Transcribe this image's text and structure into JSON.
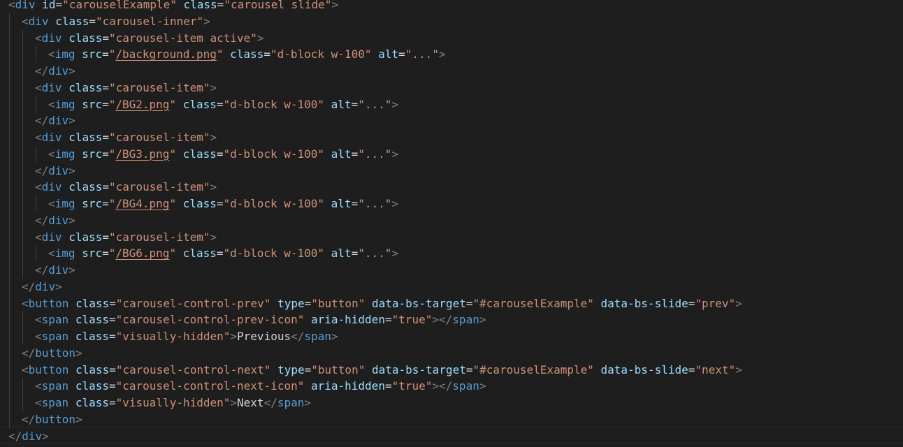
{
  "editor": {
    "language": "html",
    "theme": {
      "background": "#1e1e1e",
      "tag": "#569cd6",
      "attribute": "#9cdcfe",
      "string": "#ce9178",
      "punctuation": "#808080",
      "text": "#d4d4d4"
    },
    "lines": [
      [
        {
          "t": "p",
          "v": "<"
        },
        {
          "t": "tag",
          "v": "div"
        },
        {
          "t": "ws",
          "v": " "
        },
        {
          "t": "attr",
          "v": "id"
        },
        {
          "t": "eq",
          "v": "="
        },
        {
          "t": "str",
          "v": "\"carouselExample\""
        },
        {
          "t": "ws",
          "v": " "
        },
        {
          "t": "attr",
          "v": "class"
        },
        {
          "t": "eq",
          "v": "="
        },
        {
          "t": "str",
          "v": "\"carousel slide\""
        },
        {
          "t": "p",
          "v": ">"
        }
      ],
      [
        {
          "t": "p",
          "v": "<"
        },
        {
          "t": "tag",
          "v": "div"
        },
        {
          "t": "ws",
          "v": " "
        },
        {
          "t": "attr",
          "v": "class"
        },
        {
          "t": "eq",
          "v": "="
        },
        {
          "t": "str",
          "v": "\"carousel-inner\""
        },
        {
          "t": "p",
          "v": ">"
        }
      ],
      [
        {
          "t": "p",
          "v": "<"
        },
        {
          "t": "tag",
          "v": "div"
        },
        {
          "t": "ws",
          "v": " "
        },
        {
          "t": "attr",
          "v": "class"
        },
        {
          "t": "eq",
          "v": "="
        },
        {
          "t": "str",
          "v": "\"carousel-item active\""
        },
        {
          "t": "p",
          "v": ">"
        }
      ],
      [
        {
          "t": "p",
          "v": "<"
        },
        {
          "t": "tag",
          "v": "img"
        },
        {
          "t": "ws",
          "v": " "
        },
        {
          "t": "attr",
          "v": "src"
        },
        {
          "t": "eq",
          "v": "="
        },
        {
          "t": "str",
          "v": "\""
        },
        {
          "t": "link",
          "v": "/background.png"
        },
        {
          "t": "str",
          "v": "\""
        },
        {
          "t": "ws",
          "v": " "
        },
        {
          "t": "attr",
          "v": "class"
        },
        {
          "t": "eq",
          "v": "="
        },
        {
          "t": "str",
          "v": "\"d-block w-100\""
        },
        {
          "t": "ws",
          "v": " "
        },
        {
          "t": "attr",
          "v": "alt"
        },
        {
          "t": "eq",
          "v": "="
        },
        {
          "t": "str",
          "v": "\"...\""
        },
        {
          "t": "p",
          "v": ">"
        }
      ],
      [
        {
          "t": "p",
          "v": "</"
        },
        {
          "t": "tag",
          "v": "div"
        },
        {
          "t": "p",
          "v": ">"
        }
      ],
      [
        {
          "t": "p",
          "v": "<"
        },
        {
          "t": "tag",
          "v": "div"
        },
        {
          "t": "ws",
          "v": " "
        },
        {
          "t": "attr",
          "v": "class"
        },
        {
          "t": "eq",
          "v": "="
        },
        {
          "t": "str",
          "v": "\"carousel-item\""
        },
        {
          "t": "p",
          "v": ">"
        }
      ],
      [
        {
          "t": "p",
          "v": "<"
        },
        {
          "t": "tag",
          "v": "img"
        },
        {
          "t": "ws",
          "v": " "
        },
        {
          "t": "attr",
          "v": "src"
        },
        {
          "t": "eq",
          "v": "="
        },
        {
          "t": "str",
          "v": "\""
        },
        {
          "t": "link",
          "v": "/BG2.png"
        },
        {
          "t": "str",
          "v": "\""
        },
        {
          "t": "ws",
          "v": " "
        },
        {
          "t": "attr",
          "v": "class"
        },
        {
          "t": "eq",
          "v": "="
        },
        {
          "t": "str",
          "v": "\"d-block w-100\""
        },
        {
          "t": "ws",
          "v": " "
        },
        {
          "t": "attr",
          "v": "alt"
        },
        {
          "t": "eq",
          "v": "="
        },
        {
          "t": "str",
          "v": "\"...\""
        },
        {
          "t": "p",
          "v": ">"
        }
      ],
      [
        {
          "t": "p",
          "v": "</"
        },
        {
          "t": "tag",
          "v": "div"
        },
        {
          "t": "p",
          "v": ">"
        }
      ],
      [
        {
          "t": "p",
          "v": "<"
        },
        {
          "t": "tag",
          "v": "div"
        },
        {
          "t": "ws",
          "v": " "
        },
        {
          "t": "attr",
          "v": "class"
        },
        {
          "t": "eq",
          "v": "="
        },
        {
          "t": "str",
          "v": "\"carousel-item\""
        },
        {
          "t": "p",
          "v": ">"
        }
      ],
      [
        {
          "t": "p",
          "v": "<"
        },
        {
          "t": "tag",
          "v": "img"
        },
        {
          "t": "ws",
          "v": " "
        },
        {
          "t": "attr",
          "v": "src"
        },
        {
          "t": "eq",
          "v": "="
        },
        {
          "t": "str",
          "v": "\""
        },
        {
          "t": "link",
          "v": "/BG3.png"
        },
        {
          "t": "str",
          "v": "\""
        },
        {
          "t": "ws",
          "v": " "
        },
        {
          "t": "attr",
          "v": "class"
        },
        {
          "t": "eq",
          "v": "="
        },
        {
          "t": "str",
          "v": "\"d-block w-100\""
        },
        {
          "t": "ws",
          "v": " "
        },
        {
          "t": "attr",
          "v": "alt"
        },
        {
          "t": "eq",
          "v": "="
        },
        {
          "t": "str",
          "v": "\"...\""
        },
        {
          "t": "p",
          "v": ">"
        }
      ],
      [
        {
          "t": "p",
          "v": "</"
        },
        {
          "t": "tag",
          "v": "div"
        },
        {
          "t": "p",
          "v": ">"
        }
      ],
      [
        {
          "t": "p",
          "v": "<"
        },
        {
          "t": "tag",
          "v": "div"
        },
        {
          "t": "ws",
          "v": " "
        },
        {
          "t": "attr",
          "v": "class"
        },
        {
          "t": "eq",
          "v": "="
        },
        {
          "t": "str",
          "v": "\"carousel-item\""
        },
        {
          "t": "p",
          "v": ">"
        }
      ],
      [
        {
          "t": "p",
          "v": "<"
        },
        {
          "t": "tag",
          "v": "img"
        },
        {
          "t": "ws",
          "v": " "
        },
        {
          "t": "attr",
          "v": "src"
        },
        {
          "t": "eq",
          "v": "="
        },
        {
          "t": "str",
          "v": "\""
        },
        {
          "t": "link",
          "v": "/BG4.png"
        },
        {
          "t": "str",
          "v": "\""
        },
        {
          "t": "ws",
          "v": " "
        },
        {
          "t": "attr",
          "v": "class"
        },
        {
          "t": "eq",
          "v": "="
        },
        {
          "t": "str",
          "v": "\"d-block w-100\""
        },
        {
          "t": "ws",
          "v": " "
        },
        {
          "t": "attr",
          "v": "alt"
        },
        {
          "t": "eq",
          "v": "="
        },
        {
          "t": "str",
          "v": "\"...\""
        },
        {
          "t": "p",
          "v": ">"
        }
      ],
      [
        {
          "t": "p",
          "v": "</"
        },
        {
          "t": "tag",
          "v": "div"
        },
        {
          "t": "p",
          "v": ">"
        }
      ],
      [
        {
          "t": "p",
          "v": "<"
        },
        {
          "t": "tag",
          "v": "div"
        },
        {
          "t": "ws",
          "v": " "
        },
        {
          "t": "attr",
          "v": "class"
        },
        {
          "t": "eq",
          "v": "="
        },
        {
          "t": "str",
          "v": "\"carousel-item\""
        },
        {
          "t": "p",
          "v": ">"
        }
      ],
      [
        {
          "t": "p",
          "v": "<"
        },
        {
          "t": "tag",
          "v": "img"
        },
        {
          "t": "ws",
          "v": " "
        },
        {
          "t": "attr",
          "v": "src"
        },
        {
          "t": "eq",
          "v": "="
        },
        {
          "t": "str",
          "v": "\""
        },
        {
          "t": "link",
          "v": "/BG6.png"
        },
        {
          "t": "str",
          "v": "\""
        },
        {
          "t": "ws",
          "v": " "
        },
        {
          "t": "attr",
          "v": "class"
        },
        {
          "t": "eq",
          "v": "="
        },
        {
          "t": "str",
          "v": "\"d-block w-100\""
        },
        {
          "t": "ws",
          "v": " "
        },
        {
          "t": "attr",
          "v": "alt"
        },
        {
          "t": "eq",
          "v": "="
        },
        {
          "t": "str",
          "v": "\"...\""
        },
        {
          "t": "p",
          "v": ">"
        }
      ],
      [
        {
          "t": "p",
          "v": "</"
        },
        {
          "t": "tag",
          "v": "div"
        },
        {
          "t": "p",
          "v": ">"
        }
      ],
      [
        {
          "t": "p",
          "v": "</"
        },
        {
          "t": "tag",
          "v": "div"
        },
        {
          "t": "p",
          "v": ">"
        }
      ],
      [
        {
          "t": "p",
          "v": "<"
        },
        {
          "t": "tag",
          "v": "button"
        },
        {
          "t": "ws",
          "v": " "
        },
        {
          "t": "attr",
          "v": "class"
        },
        {
          "t": "eq",
          "v": "="
        },
        {
          "t": "str",
          "v": "\"carousel-control-prev\""
        },
        {
          "t": "ws",
          "v": " "
        },
        {
          "t": "attr",
          "v": "type"
        },
        {
          "t": "eq",
          "v": "="
        },
        {
          "t": "str",
          "v": "\"button\""
        },
        {
          "t": "ws",
          "v": " "
        },
        {
          "t": "attr",
          "v": "data-bs-target"
        },
        {
          "t": "eq",
          "v": "="
        },
        {
          "t": "str",
          "v": "\"#carouselExample\""
        },
        {
          "t": "ws",
          "v": " "
        },
        {
          "t": "attr",
          "v": "data-bs-slide"
        },
        {
          "t": "eq",
          "v": "="
        },
        {
          "t": "str",
          "v": "\"prev\""
        },
        {
          "t": "p",
          "v": ">"
        }
      ],
      [
        {
          "t": "p",
          "v": "<"
        },
        {
          "t": "tag",
          "v": "span"
        },
        {
          "t": "ws",
          "v": " "
        },
        {
          "t": "attr",
          "v": "class"
        },
        {
          "t": "eq",
          "v": "="
        },
        {
          "t": "str",
          "v": "\"carousel-control-prev-icon\""
        },
        {
          "t": "ws",
          "v": " "
        },
        {
          "t": "attr",
          "v": "aria-hidden"
        },
        {
          "t": "eq",
          "v": "="
        },
        {
          "t": "str",
          "v": "\"true\""
        },
        {
          "t": "p",
          "v": "></"
        },
        {
          "t": "tag",
          "v": "span"
        },
        {
          "t": "p",
          "v": ">"
        }
      ],
      [
        {
          "t": "p",
          "v": "<"
        },
        {
          "t": "tag",
          "v": "span"
        },
        {
          "t": "ws",
          "v": " "
        },
        {
          "t": "attr",
          "v": "class"
        },
        {
          "t": "eq",
          "v": "="
        },
        {
          "t": "str",
          "v": "\"visually-hidden\""
        },
        {
          "t": "p",
          "v": ">"
        },
        {
          "t": "text",
          "v": "Previous"
        },
        {
          "t": "p",
          "v": "</"
        },
        {
          "t": "tag",
          "v": "span"
        },
        {
          "t": "p",
          "v": ">"
        }
      ],
      [
        {
          "t": "p",
          "v": "</"
        },
        {
          "t": "tag",
          "v": "button"
        },
        {
          "t": "p",
          "v": ">"
        }
      ],
      [
        {
          "t": "p",
          "v": "<"
        },
        {
          "t": "tag",
          "v": "button"
        },
        {
          "t": "ws",
          "v": " "
        },
        {
          "t": "attr",
          "v": "class"
        },
        {
          "t": "eq",
          "v": "="
        },
        {
          "t": "str",
          "v": "\"carousel-control-next\""
        },
        {
          "t": "ws",
          "v": " "
        },
        {
          "t": "attr",
          "v": "type"
        },
        {
          "t": "eq",
          "v": "="
        },
        {
          "t": "str",
          "v": "\"button\""
        },
        {
          "t": "ws",
          "v": " "
        },
        {
          "t": "attr",
          "v": "data-bs-target"
        },
        {
          "t": "eq",
          "v": "="
        },
        {
          "t": "str",
          "v": "\"#carouselExample\""
        },
        {
          "t": "ws",
          "v": " "
        },
        {
          "t": "attr",
          "v": "data-bs-slide"
        },
        {
          "t": "eq",
          "v": "="
        },
        {
          "t": "str",
          "v": "\"next\""
        },
        {
          "t": "p",
          "v": ">"
        }
      ],
      [
        {
          "t": "p",
          "v": "<"
        },
        {
          "t": "tag",
          "v": "span"
        },
        {
          "t": "ws",
          "v": " "
        },
        {
          "t": "attr",
          "v": "class"
        },
        {
          "t": "eq",
          "v": "="
        },
        {
          "t": "str",
          "v": "\"carousel-control-next-icon\""
        },
        {
          "t": "ws",
          "v": " "
        },
        {
          "t": "attr",
          "v": "aria-hidden"
        },
        {
          "t": "eq",
          "v": "="
        },
        {
          "t": "str",
          "v": "\"true\""
        },
        {
          "t": "p",
          "v": "></"
        },
        {
          "t": "tag",
          "v": "span"
        },
        {
          "t": "p",
          "v": ">"
        }
      ],
      [
        {
          "t": "p",
          "v": "<"
        },
        {
          "t": "tag",
          "v": "span"
        },
        {
          "t": "ws",
          "v": " "
        },
        {
          "t": "attr",
          "v": "class"
        },
        {
          "t": "eq",
          "v": "="
        },
        {
          "t": "str",
          "v": "\"visually-hidden\""
        },
        {
          "t": "p",
          "v": ">"
        },
        {
          "t": "text",
          "v": "Next"
        },
        {
          "t": "p",
          "v": "</"
        },
        {
          "t": "tag",
          "v": "span"
        },
        {
          "t": "p",
          "v": ">"
        }
      ],
      [
        {
          "t": "p",
          "v": "</"
        },
        {
          "t": "tag",
          "v": "button"
        },
        {
          "t": "p",
          "v": ">"
        }
      ],
      [
        {
          "t": "p",
          "v": "</"
        },
        {
          "t": "tag",
          "v": "div"
        },
        {
          "t": "p",
          "v": ">"
        }
      ]
    ]
  }
}
